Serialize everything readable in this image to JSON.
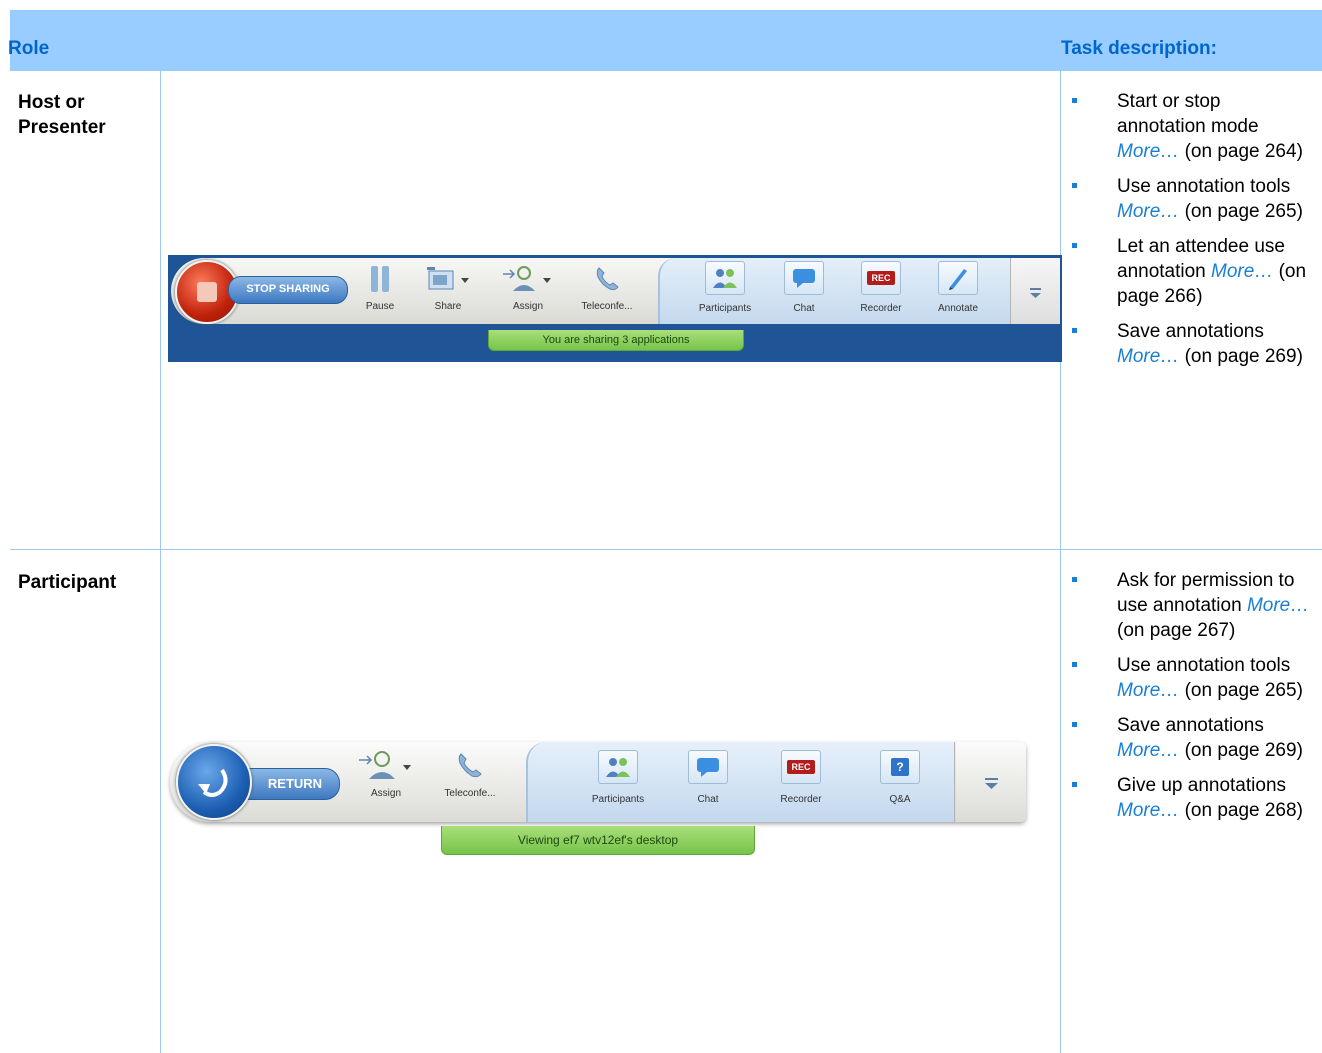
{
  "header": {
    "role": "Role",
    "task": "Task description:"
  },
  "rows": [
    {
      "role": "Host or Presenter",
      "tasks": [
        {
          "text": "Start or stop annotation mode ",
          "more": "More…",
          "ref": " (on page 264)"
        },
        {
          "text": "Use annotation tools ",
          "more": "More…",
          "ref": " (on page 265)"
        },
        {
          "text": "Let an attendee use annotation ",
          "more": "More…",
          "ref": " (on page 266)"
        },
        {
          "text": "Save annotations ",
          "more": "More…",
          "ref": " (on page 269)"
        }
      ],
      "toolbar": {
        "main_button": "STOP SHARING",
        "items": [
          "Pause",
          "Share",
          "Assign",
          "Teleconfe...",
          "Participants",
          "Chat",
          "Recorder",
          "Annotate"
        ],
        "recorder_badge": "REC",
        "status": "You are sharing 3 applications"
      }
    },
    {
      "role": "Participant",
      "tasks": [
        {
          "text": "Ask for permission to use annotation ",
          "more": "More…",
          "ref": " (on page 267)"
        },
        {
          "text": "Use annotation tools ",
          "more": "More…",
          "ref": " (on page 265)"
        },
        {
          "text": "Save annotations ",
          "more": "More…",
          "ref": " (on page 269)"
        },
        {
          "text": "Give up annotations ",
          "more": "More…",
          "ref": " (on page 268)"
        }
      ],
      "toolbar": {
        "main_button": "RETURN",
        "items": [
          "Assign",
          "Teleconfe...",
          "Participants",
          "Chat",
          "Recorder",
          "Q&A"
        ],
        "recorder_badge": "REC",
        "qa_badge": "?",
        "status": "Viewing ef7 wtv12ef's desktop"
      }
    }
  ],
  "colors": {
    "header_bg": "#99ccff",
    "heading": "#0066cc",
    "link": "#1a7fd4",
    "rule": "#9ec8ef"
  }
}
